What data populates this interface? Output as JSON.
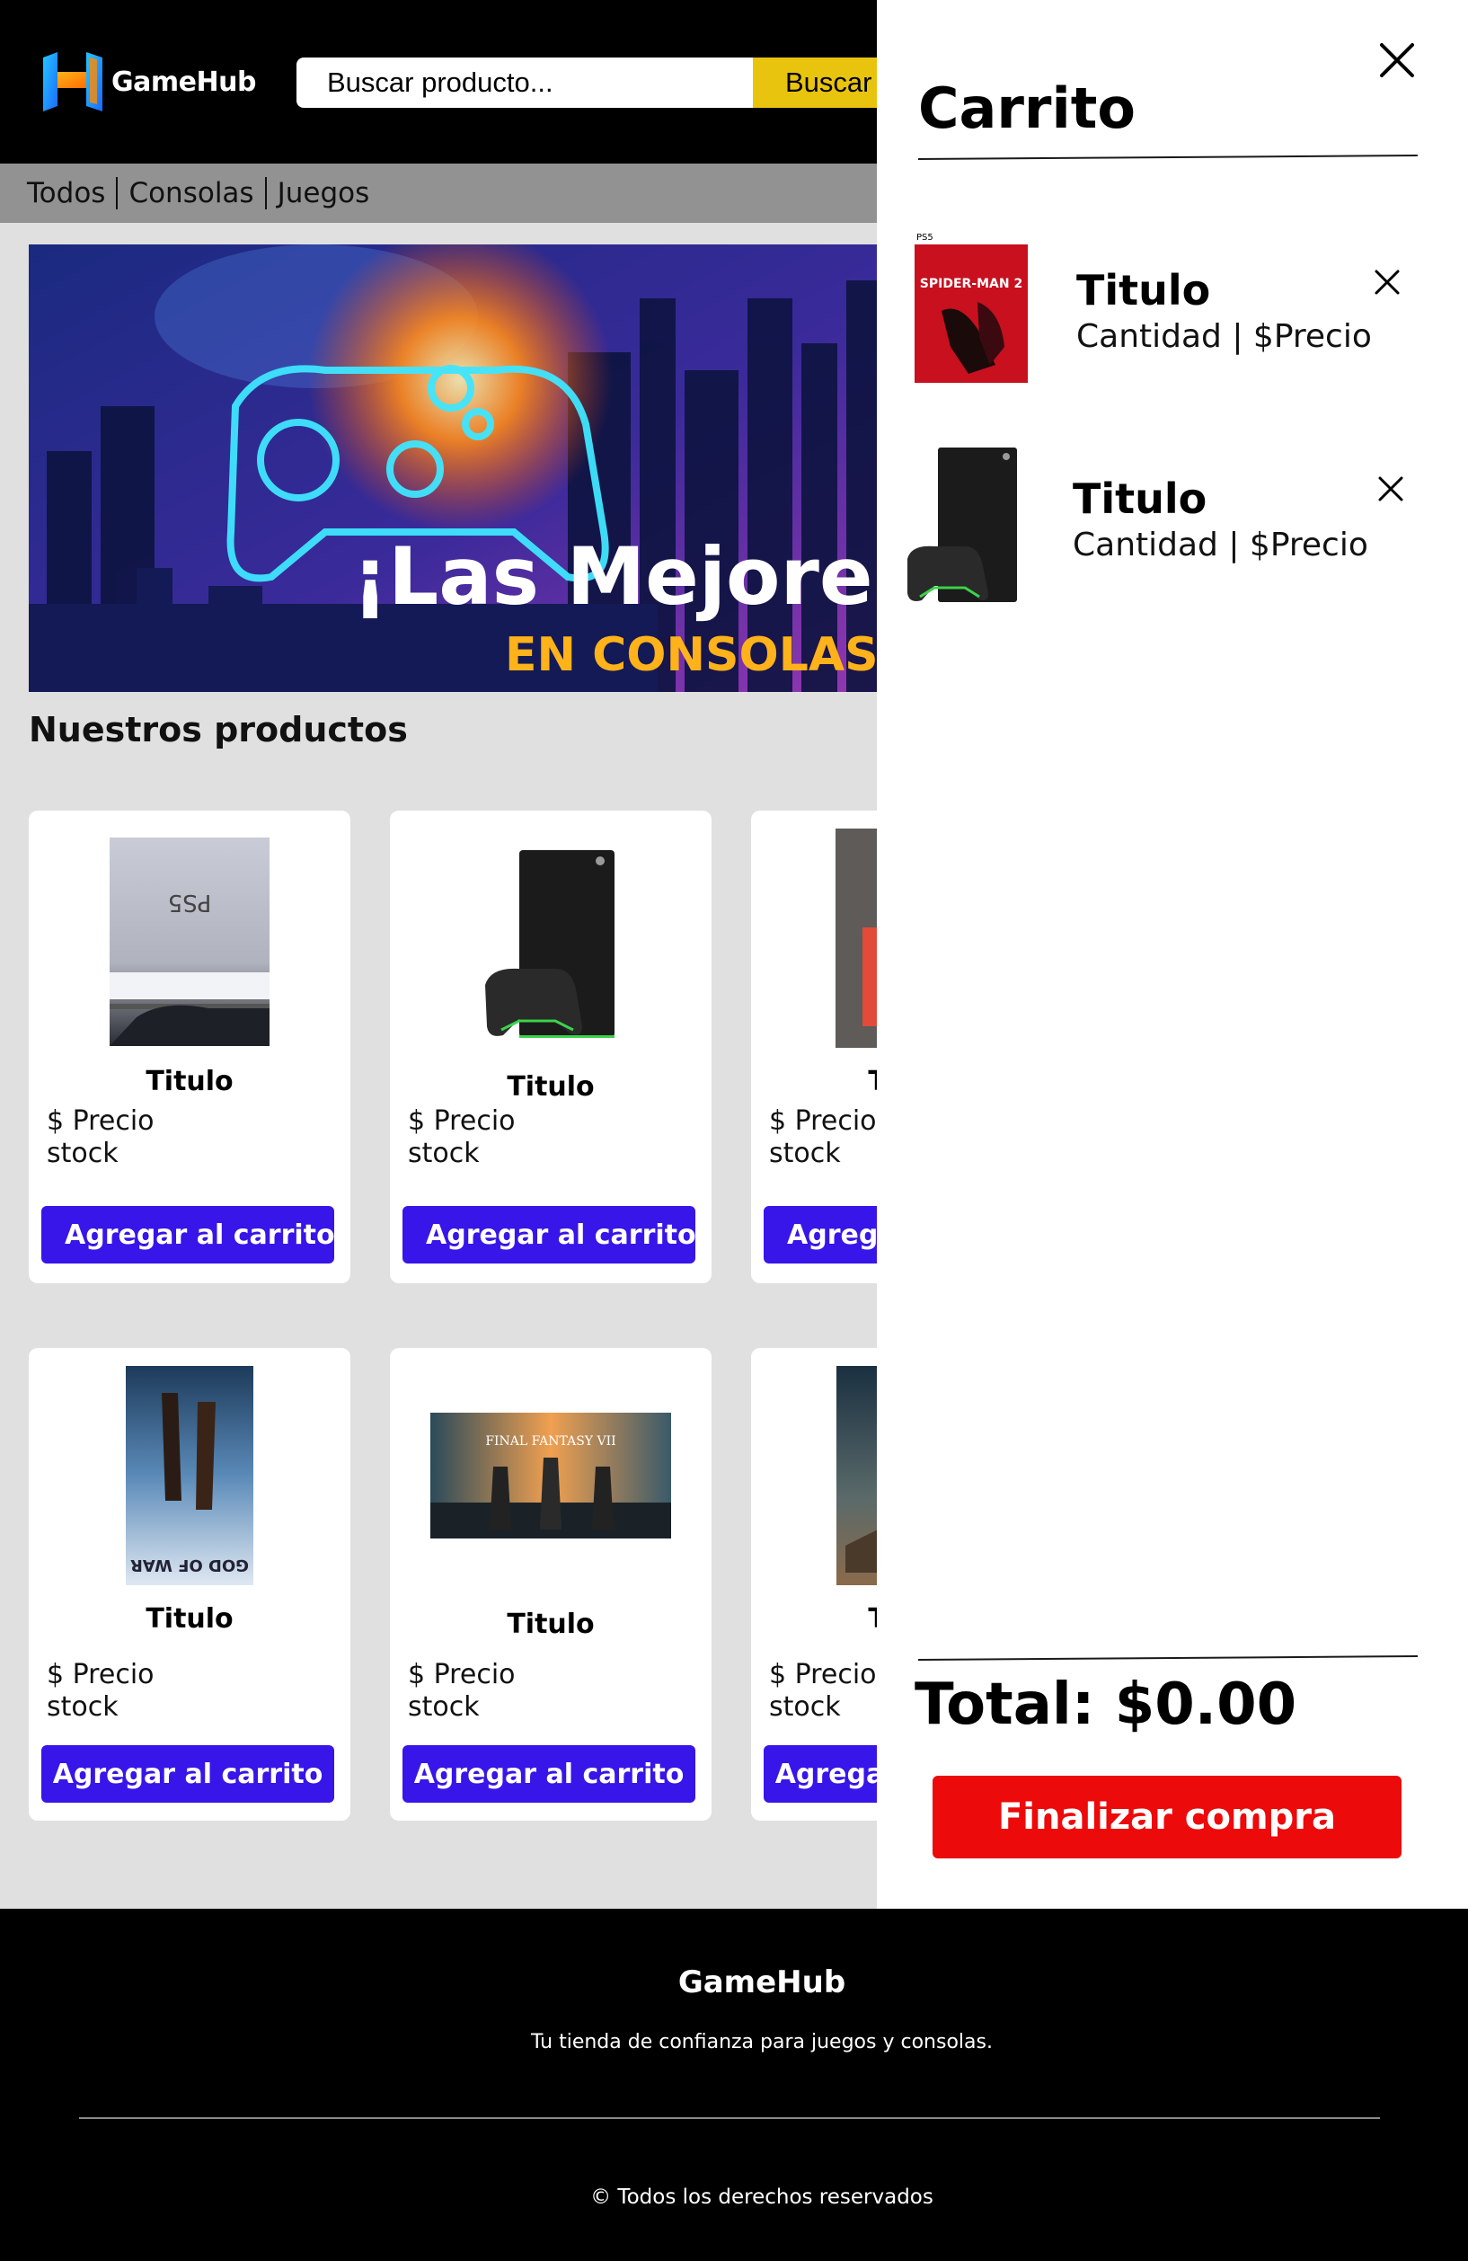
{
  "header": {
    "logo_text": "GameHub",
    "search_placeholder": "Buscar producto...",
    "search_button": "Buscar"
  },
  "nav": {
    "items": [
      "Todos",
      "Consolas",
      "Juegos"
    ]
  },
  "banner": {
    "headline": "¡Las Mejores",
    "subline": "EN CONSOLAS Y"
  },
  "products_section": {
    "title": "Nuestros productos"
  },
  "products": [
    {
      "title": "Titulo",
      "price": "$ Precio",
      "stock": "stock",
      "button": "Agregar al carrito",
      "image": "ps5-console"
    },
    {
      "title": "Titulo",
      "price": "$ Precio",
      "stock": "stock",
      "button": "Agregar al carrito",
      "image": "xbox-series-x"
    },
    {
      "title": "Titulo",
      "price": "$ Precio",
      "stock": "stock",
      "button": "Agregar al carrito",
      "image": "nintendo-switch"
    },
    {
      "title": "Titulo",
      "price": "$ Precio",
      "stock": "stock",
      "button": "Agregar al carrito",
      "image": "god-of-war-cover"
    },
    {
      "title": "Titulo",
      "price": "$ Precio",
      "stock": "stock",
      "button": "Agregar al carrito",
      "image": "final-fantasy-vii-art"
    },
    {
      "title": "Titulo",
      "price": "$ Precio",
      "stock": "stock",
      "button": "Agregar al carrito",
      "image": "starfield-cover"
    }
  ],
  "cart": {
    "title": "Carrito",
    "items": [
      {
        "title": "Titulo",
        "meta": "Cantidad | $Precio",
        "image": "spider-man-2-ps5-cover",
        "cover_text": "SPIDER-MAN 2",
        "platform": "PS5"
      },
      {
        "title": "Titulo",
        "meta": "Cantidad | $Precio",
        "image": "xbox-series-x"
      }
    ],
    "total": "Total: $0.00",
    "checkout_button": "Finalizar compra"
  },
  "footer": {
    "brand": "GameHub",
    "tagline": "Tu tienda de confianza para juegos y consolas.",
    "copyright": "© Todos los derechos reservados"
  },
  "colors": {
    "accent_blue": "#3815e8",
    "search_yellow": "#e8c40e",
    "checkout_red": "#ec0a0a",
    "nav_gray": "#929292",
    "page_bg": "#e0e0e0"
  }
}
